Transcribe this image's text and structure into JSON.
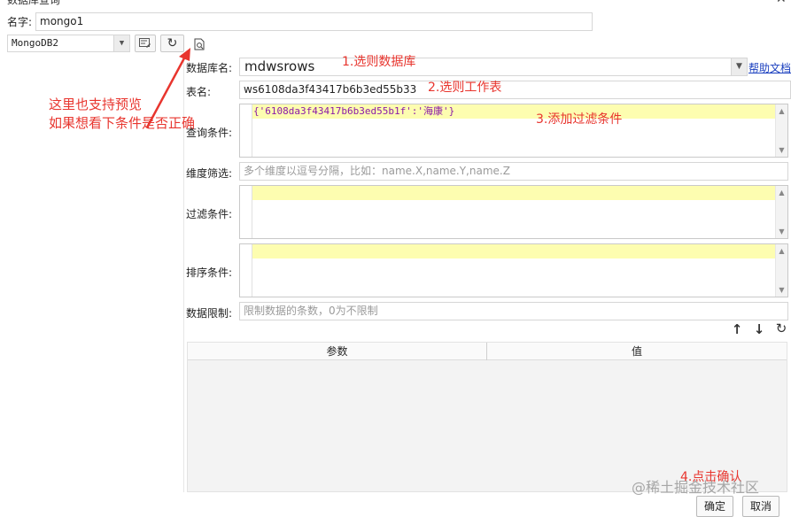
{
  "window": {
    "title": "数据库查询"
  },
  "name_row": {
    "label": "名字:",
    "value": "mongo1"
  },
  "db_selector": {
    "value": "MongoDB2"
  },
  "form": {
    "database": {
      "label": "数据库名:",
      "value": "mdwsrows",
      "help": "帮助文档"
    },
    "table": {
      "label": "表名:",
      "value": "ws6108da3f43417b6b3ed55b33"
    },
    "query": {
      "label": "查询条件:",
      "code": "{'6108da3f43417b6b3ed55b1f':'海康'}"
    },
    "dimension": {
      "label": "维度筛选:",
      "placeholder": "多个维度以逗号分隔，比如：name.X,name.Y,name.Z"
    },
    "filter": {
      "label": "过滤条件:"
    },
    "sort": {
      "label": "排序条件:"
    },
    "limit": {
      "label": "数据限制:",
      "placeholder": "限制数据的条数，0为不限制"
    }
  },
  "params_table": {
    "columns": [
      "参数",
      "值"
    ]
  },
  "buttons": {
    "ok": "确定",
    "cancel": "取消"
  },
  "annotations": {
    "preview_line1": "这里也支持预览",
    "preview_line2": "如果想看下条件是否正确",
    "step1": "1.选则数据库",
    "step2": "2.选则工作表",
    "step3": "3.添加过滤条件",
    "step4": "4.点击确认"
  },
  "watermark": "@稀土掘金技术社区",
  "colors": {
    "annotation": "#e8352e",
    "highlight": "#fdfdb0",
    "link": "#1a3fbf"
  }
}
